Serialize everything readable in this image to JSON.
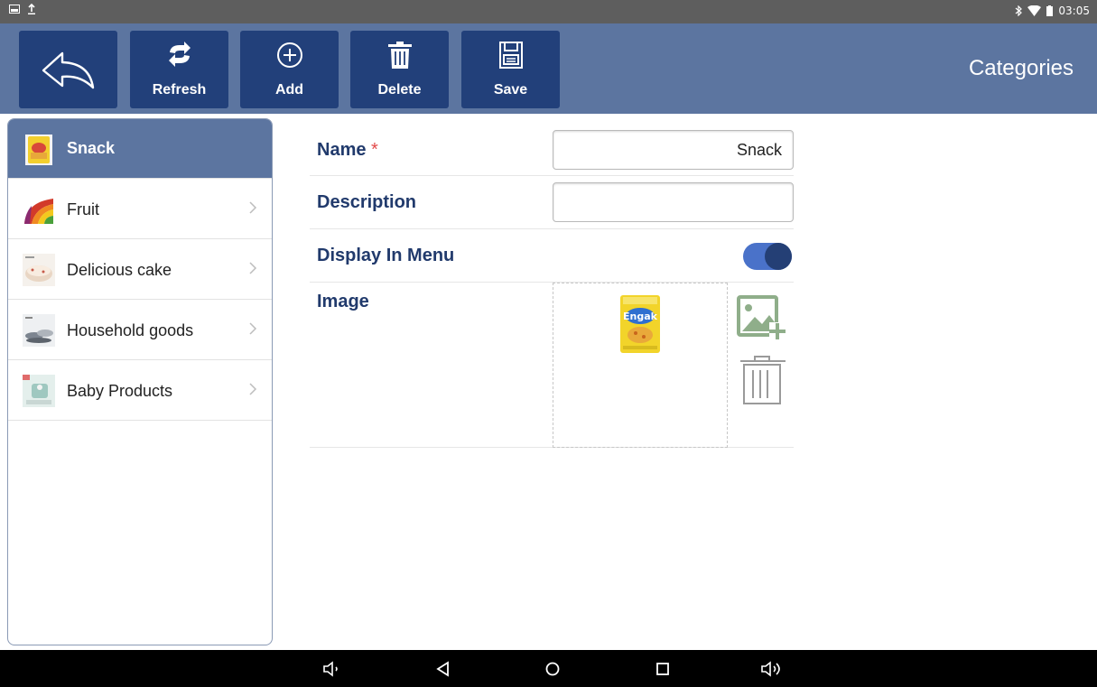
{
  "status_bar": {
    "time": "03:05",
    "left_icons": [
      "image-icon",
      "upload-icon"
    ],
    "right_icons": [
      "bluetooth-icon",
      "wifi-icon",
      "battery-icon"
    ]
  },
  "toolbar": {
    "back_icon": "back-arrow-icon",
    "refresh_label": "Refresh",
    "add_label": "Add",
    "delete_label": "Delete",
    "save_label": "Save",
    "title": "Categories"
  },
  "sidebar": {
    "items": [
      {
        "label": "Snack",
        "selected": true,
        "thumb": "snack-thumb"
      },
      {
        "label": "Fruit",
        "selected": false,
        "thumb": "fruit-thumb"
      },
      {
        "label": "Delicious cake",
        "selected": false,
        "thumb": "cake-thumb"
      },
      {
        "label": "Household goods",
        "selected": false,
        "thumb": "household-thumb"
      },
      {
        "label": "Baby Products",
        "selected": false,
        "thumb": "baby-thumb"
      }
    ]
  },
  "form": {
    "name_label": "Name",
    "required_mark": "*",
    "name_value": "Snack",
    "description_label": "Description",
    "description_value": "",
    "display_label": "Display In Menu",
    "display_on": true,
    "image_label": "Image"
  },
  "colors": {
    "header": "#5c75a0",
    "button": "#22407a",
    "label": "#213a6c",
    "toggle_track": "#4a72c9",
    "toggle_knob": "#243f75",
    "add_image": "#8fae8a"
  },
  "nav_bar": {
    "icons": [
      "volume-down-icon",
      "back-triangle-icon",
      "home-circle-icon",
      "recents-square-icon",
      "volume-up-icon"
    ]
  }
}
